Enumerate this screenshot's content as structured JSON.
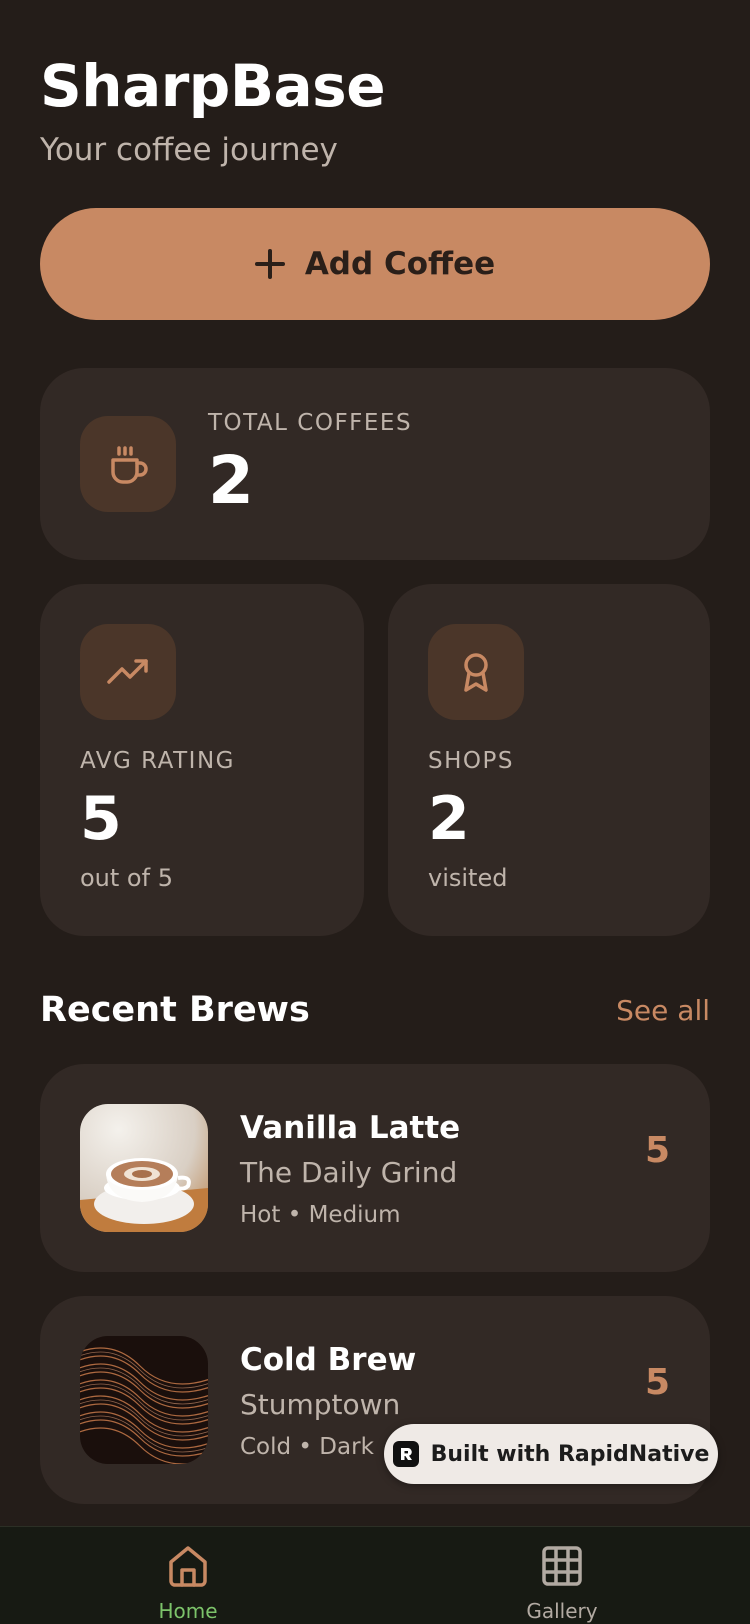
{
  "header": {
    "title": "SharpBase",
    "subtitle": "Your coffee journey"
  },
  "add_button": {
    "label": "Add Coffee",
    "icon": "plus-icon"
  },
  "stats": {
    "total": {
      "label": "TOTAL COFFEES",
      "value": "2",
      "icon": "coffee-cup-icon"
    },
    "avg_rating": {
      "label": "AVG RATING",
      "value": "5",
      "sub": "out of 5",
      "icon": "trending-up-icon"
    },
    "shops": {
      "label": "SHOPS",
      "value": "2",
      "sub": "visited",
      "icon": "award-icon"
    }
  },
  "recent": {
    "title": "Recent Brews",
    "see_all": "See all",
    "items": [
      {
        "name": "Vanilla Latte",
        "shop": "The Daily Grind",
        "meta": "Hot • Medium",
        "rating": "5"
      },
      {
        "name": "Cold Brew",
        "shop": "Stumptown",
        "meta": "Cold • Dark",
        "rating": "5"
      }
    ]
  },
  "badge": {
    "text": "Built with RapidNative"
  },
  "tabs": [
    {
      "label": "Home",
      "icon": "home-icon",
      "active": true
    },
    {
      "label": "Gallery",
      "icon": "grid-icon",
      "active": false
    }
  ],
  "colors": {
    "background": "#241d19",
    "card": "#322925",
    "accent": "#c88963",
    "active_tab": "#7cc36a",
    "inactive_tab": "#b2aaa2",
    "tabbar": "#171a13"
  }
}
